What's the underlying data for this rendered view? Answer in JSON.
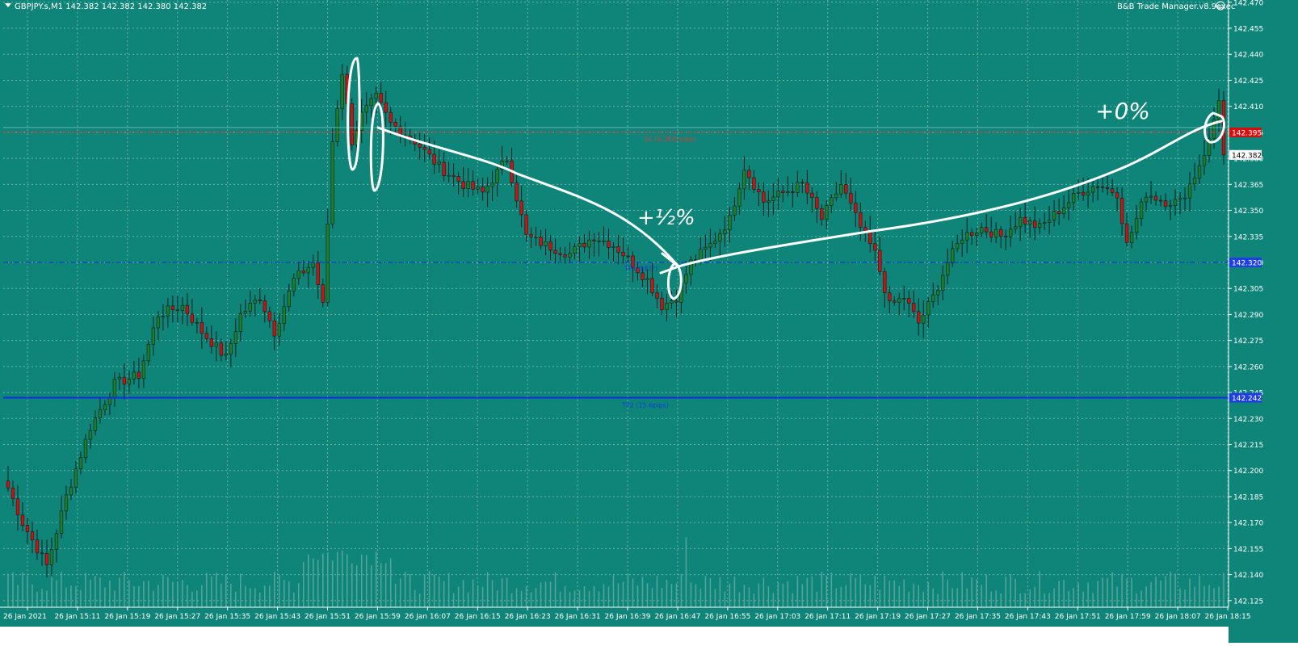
{
  "header": {
    "symbol_info": "GBPJPY.s,M1  142.382 142.382 142.380 142.382",
    "ea_label": "B&B Trade Manager.v8.9exec",
    "smiley_icon": "smiley-face-icon"
  },
  "colors": {
    "background": "#0f857a",
    "grid": "#6fb0a9",
    "bull_candle": "#1e7f2a",
    "bear_candle": "#d40f0f",
    "wick": "#0a1f1c",
    "volume": "#55a59d",
    "sl_line": "#d43b3b",
    "tp_line": "#0f2ee0",
    "annotation": "#ffffff"
  },
  "lines": {
    "sl": {
      "price": 142.395,
      "label": "SL (0.2R/0 pips)",
      "tag": "142.395"
    },
    "tp1": {
      "price": 142.32,
      "label": "TP1 B/E(?)",
      "tag": "142.320"
    },
    "tp2": {
      "price": 142.242,
      "label": "TP2 (15.6pips)",
      "tag": "142.242"
    },
    "bid": {
      "price": 142.382,
      "tag": "142.382"
    }
  },
  "annotations": {
    "half": "+½%",
    "zero": "+0%"
  },
  "chart_data": {
    "type": "candlestick",
    "title": "GBPJPY.s,M1",
    "x_ticks": [
      "26 Jan 2021",
      "26 Jan 15:11",
      "26 Jan 15:19",
      "26 Jan 15:27",
      "26 Jan 15:35",
      "26 Jan 15:43",
      "26 Jan 15:51",
      "26 Jan 15:59",
      "26 Jan 16:07",
      "26 Jan 16:15",
      "26 Jan 16:23",
      "26 Jan 16:31",
      "26 Jan 16:39",
      "26 Jan 16:47",
      "26 Jan 16:55",
      "26 Jan 17:03",
      "26 Jan 17:11",
      "26 Jan 17:19",
      "26 Jan 17:27",
      "26 Jan 17:35",
      "26 Jan 17:43",
      "26 Jan 17:51",
      "26 Jan 17:59",
      "26 Jan 18:07",
      "26 Jan 18:15"
    ],
    "y_ticks": [
      "142.470",
      "142.455",
      "142.440",
      "142.425",
      "142.410",
      "142.395",
      "142.380",
      "142.365",
      "142.350",
      "142.335",
      "142.320",
      "142.305",
      "142.290",
      "142.275",
      "142.260",
      "142.245",
      "142.230",
      "142.215",
      "142.200",
      "142.185",
      "142.170",
      "142.155",
      "142.140",
      "142.125"
    ],
    "ylim": [
      142.1212,
      142.4713
    ],
    "anchors": [
      {
        "i": 0,
        "p": 142.19
      },
      {
        "i": 3,
        "p": 142.17
      },
      {
        "i": 8,
        "p": 142.145
      },
      {
        "i": 12,
        "p": 142.185
      },
      {
        "i": 17,
        "p": 142.225
      },
      {
        "i": 22,
        "p": 142.25
      },
      {
        "i": 27,
        "p": 142.255
      },
      {
        "i": 31,
        "p": 142.29
      },
      {
        "i": 36,
        "p": 142.295
      },
      {
        "i": 40,
        "p": 142.28
      },
      {
        "i": 45,
        "p": 142.265
      },
      {
        "i": 48,
        "p": 142.29
      },
      {
        "i": 52,
        "p": 142.3
      },
      {
        "i": 55,
        "p": 142.28
      },
      {
        "i": 59,
        "p": 142.31
      },
      {
        "i": 63,
        "p": 142.32
      },
      {
        "i": 65,
        "p": 142.295
      },
      {
        "i": 67,
        "p": 142.39
      },
      {
        "i": 69,
        "p": 142.43
      },
      {
        "i": 71,
        "p": 142.39
      },
      {
        "i": 73,
        "p": 142.405
      },
      {
        "i": 76,
        "p": 142.415
      },
      {
        "i": 79,
        "p": 142.4
      },
      {
        "i": 84,
        "p": 142.39
      },
      {
        "i": 89,
        "p": 142.375
      },
      {
        "i": 94,
        "p": 142.365
      },
      {
        "i": 98,
        "p": 142.36
      },
      {
        "i": 103,
        "p": 142.38
      },
      {
        "i": 107,
        "p": 142.335
      },
      {
        "i": 111,
        "p": 142.33
      },
      {
        "i": 116,
        "p": 142.325
      },
      {
        "i": 121,
        "p": 142.335
      },
      {
        "i": 125,
        "p": 142.33
      },
      {
        "i": 127,
        "p": 142.325
      },
      {
        "i": 132,
        "p": 142.31
      },
      {
        "i": 135,
        "p": 142.295
      },
      {
        "i": 138,
        "p": 142.3
      },
      {
        "i": 141,
        "p": 142.32
      },
      {
        "i": 145,
        "p": 142.33
      },
      {
        "i": 149,
        "p": 142.345
      },
      {
        "i": 152,
        "p": 142.375
      },
      {
        "i": 156,
        "p": 142.355
      },
      {
        "i": 160,
        "p": 142.36
      },
      {
        "i": 164,
        "p": 142.365
      },
      {
        "i": 168,
        "p": 142.345
      },
      {
        "i": 172,
        "p": 142.365
      },
      {
        "i": 176,
        "p": 142.34
      },
      {
        "i": 179,
        "p": 142.325
      },
      {
        "i": 182,
        "p": 142.295
      },
      {
        "i": 185,
        "p": 142.3
      },
      {
        "i": 188,
        "p": 142.285
      },
      {
        "i": 191,
        "p": 142.3
      },
      {
        "i": 194,
        "p": 142.32
      },
      {
        "i": 197,
        "p": 142.335
      },
      {
        "i": 201,
        "p": 142.34
      },
      {
        "i": 205,
        "p": 142.335
      },
      {
        "i": 209,
        "p": 142.345
      },
      {
        "i": 213,
        "p": 142.34
      },
      {
        "i": 217,
        "p": 142.35
      },
      {
        "i": 221,
        "p": 142.36
      },
      {
        "i": 225,
        "p": 142.365
      },
      {
        "i": 229,
        "p": 142.36
      },
      {
        "i": 231,
        "p": 142.33
      },
      {
        "i": 235,
        "p": 142.36
      },
      {
        "i": 239,
        "p": 142.355
      },
      {
        "i": 242,
        "p": 142.355
      },
      {
        "i": 245,
        "p": 142.37
      },
      {
        "i": 248,
        "p": 142.39
      },
      {
        "i": 250,
        "p": 142.415
      },
      {
        "i": 251,
        "p": 142.382
      }
    ],
    "volume_range": [
      0.12,
      0.62
    ]
  }
}
